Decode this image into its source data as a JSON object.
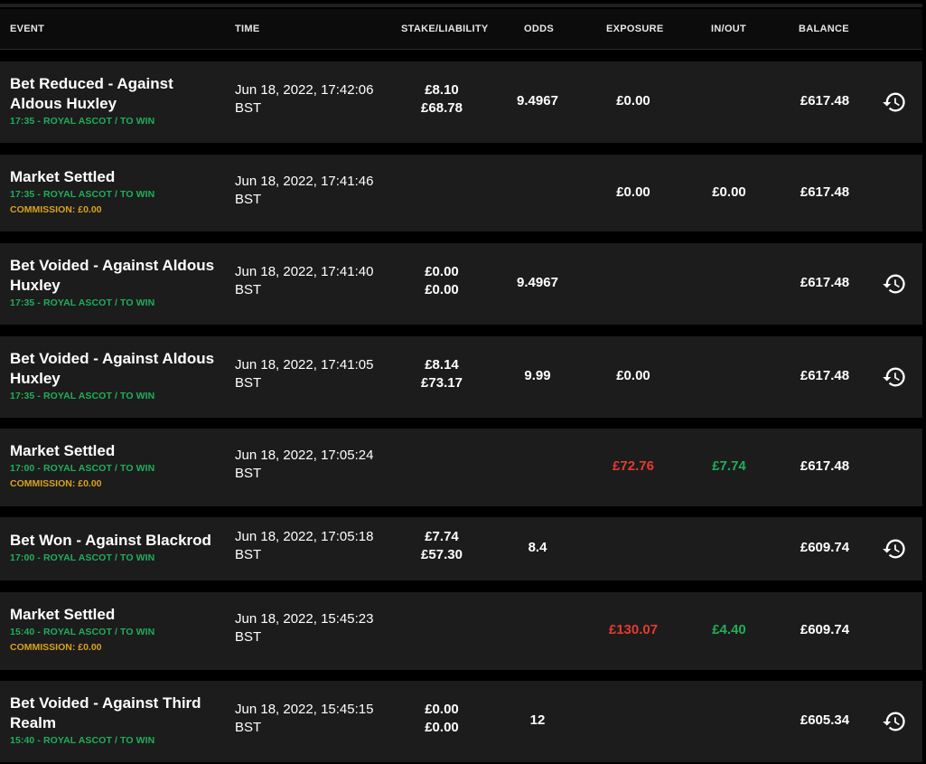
{
  "header": {
    "event": "EVENT",
    "time": "TIME",
    "stake": "STAKE/LIABILITY",
    "odds": "ODDS",
    "exposure": "EXPOSURE",
    "inout": "IN/OUT",
    "balance": "BALANCE"
  },
  "colors": {
    "green": "#1fae5a",
    "red": "#e53b30",
    "commission": "#d9a21b",
    "row": "#1c1c1c"
  },
  "rows": [
    {
      "title": "Bet Reduced - Against Aldous Huxley",
      "sub": "17:35 - ROYAL ASCOT / TO WIN",
      "commission": "",
      "time": "Jun 18, 2022, 17:42:06",
      "tz": "BST",
      "stake": "£8.10",
      "liability": "£68.78",
      "odds": "9.4967",
      "exposure": "£0.00",
      "exposure_color": "white",
      "inout": "",
      "inout_color": "white",
      "balance": "£617.48",
      "history": true
    },
    {
      "title": "Market Settled",
      "sub": "17:35 - ROYAL ASCOT / TO WIN",
      "commission": "COMMISSION: £0.00",
      "time": "Jun 18, 2022, 17:41:46",
      "tz": "BST",
      "stake": "",
      "liability": "",
      "odds": "",
      "exposure": "£0.00",
      "exposure_color": "white",
      "inout": "£0.00",
      "inout_color": "white",
      "balance": "£617.48",
      "history": false
    },
    {
      "title": "Bet Voided - Against Aldous Huxley",
      "sub": "17:35 - ROYAL ASCOT / TO WIN",
      "commission": "",
      "time": "Jun 18, 2022, 17:41:40",
      "tz": "BST",
      "stake": "£0.00",
      "liability": "£0.00",
      "odds": "9.4967",
      "exposure": "",
      "exposure_color": "white",
      "inout": "",
      "inout_color": "white",
      "balance": "£617.48",
      "history": true
    },
    {
      "title": "Bet Voided - Against Aldous Huxley",
      "sub": "17:35 - ROYAL ASCOT / TO WIN",
      "commission": "",
      "time": "Jun 18, 2022, 17:41:05",
      "tz": "BST",
      "stake": "£8.14",
      "liability": "£73.17",
      "odds": "9.99",
      "exposure": "£0.00",
      "exposure_color": "white",
      "inout": "",
      "inout_color": "white",
      "balance": "£617.48",
      "history": true
    },
    {
      "title": "Market Settled",
      "sub": "17:00 - ROYAL ASCOT / TO WIN",
      "commission": "COMMISSION: £0.00",
      "time": "Jun 18, 2022, 17:05:24",
      "tz": "BST",
      "stake": "",
      "liability": "",
      "odds": "",
      "exposure": "£72.76",
      "exposure_color": "red",
      "inout": "£7.74",
      "inout_color": "green",
      "balance": "£617.48",
      "history": false
    },
    {
      "title": "Bet Won - Against Blackrod",
      "sub": "17:00 - ROYAL ASCOT / TO WIN",
      "commission": "",
      "time": "Jun 18, 2022, 17:05:18",
      "tz": "BST",
      "stake": "£7.74",
      "liability": "£57.30",
      "odds": "8.4",
      "exposure": "",
      "exposure_color": "white",
      "inout": "",
      "inout_color": "white",
      "balance": "£609.74",
      "history": true
    },
    {
      "title": "Market Settled",
      "sub": "15:40 - ROYAL ASCOT / TO WIN",
      "commission": "COMMISSION: £0.00",
      "time": "Jun 18, 2022, 15:45:23",
      "tz": "BST",
      "stake": "",
      "liability": "",
      "odds": "",
      "exposure": "£130.07",
      "exposure_color": "red",
      "inout": "£4.40",
      "inout_color": "green",
      "balance": "£609.74",
      "history": false
    },
    {
      "title": "Bet Voided - Against Third Realm",
      "sub": "15:40 - ROYAL ASCOT / TO WIN",
      "commission": "",
      "time": "Jun 18, 2022, 15:45:15",
      "tz": "BST",
      "stake": "£0.00",
      "liability": "£0.00",
      "odds": "12",
      "exposure": "",
      "exposure_color": "white",
      "inout": "",
      "inout_color": "white",
      "balance": "£605.34",
      "history": true
    }
  ]
}
